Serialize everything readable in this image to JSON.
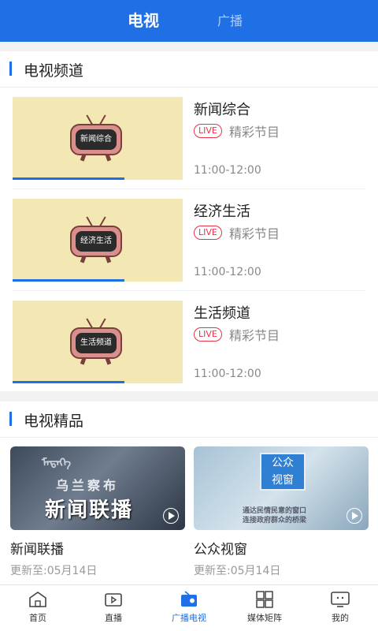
{
  "header": {
    "tab_tv": "电视",
    "tab_radio": "广播"
  },
  "tv_channels": {
    "title": "电视频道",
    "items": [
      {
        "name": "新闻综合",
        "screen_text": "新闻综合",
        "live": "LIVE",
        "subtitle": "精彩节目",
        "time": "11:00-12:00"
      },
      {
        "name": "经济生活",
        "screen_text": "经济生活",
        "live": "LIVE",
        "subtitle": "精彩节目",
        "time": "11:00-12:00"
      },
      {
        "name": "生活频道",
        "screen_text": "生活频道",
        "live": "LIVE",
        "subtitle": "精彩节目",
        "time": "11:00-12:00"
      }
    ]
  },
  "tv_picks": {
    "title": "电视精品",
    "items": [
      {
        "title": "新闻联播",
        "updated": "更新至:05月14日",
        "overlay_main": "新闻联播",
        "overlay_sub": "乌兰察布",
        "overlay_mongolian": "ᠮᠡᠳᠡᠭᠡ"
      },
      {
        "title": "公众视窗",
        "updated": "更新至:05月14日",
        "logo_line1": "公众",
        "logo_line2": "视窗",
        "slogan1": "通达民情民意的窗口",
        "slogan2": "连接政府群众的桥梁"
      }
    ]
  },
  "bottom_nav": {
    "items": [
      {
        "label": "首页",
        "icon": "home-icon"
      },
      {
        "label": "直播",
        "icon": "live-video-icon"
      },
      {
        "label": "广播电视",
        "icon": "radio-tv-icon"
      },
      {
        "label": "媒体矩阵",
        "icon": "grid-icon"
      },
      {
        "label": "我的",
        "icon": "profile-tv-icon"
      }
    ],
    "active": "广播电视"
  },
  "colors": {
    "accent": "#1f6fe5",
    "live": "#e8334a",
    "thumb_bg": "#f3e7b4"
  }
}
